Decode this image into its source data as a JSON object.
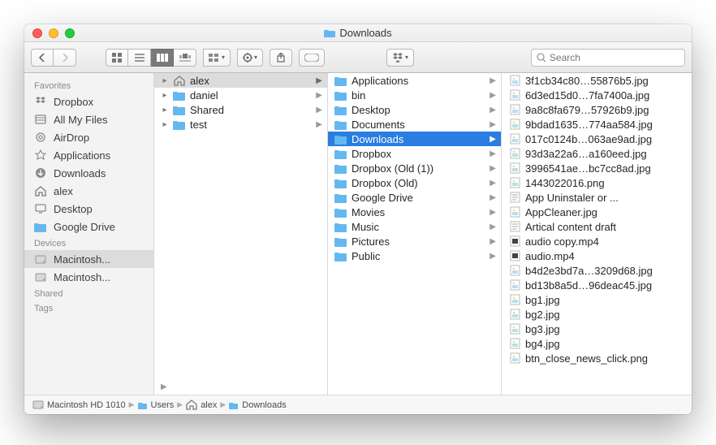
{
  "title": "Downloads",
  "search": {
    "placeholder": "Search"
  },
  "sidebar": {
    "sections": [
      {
        "header": "Favorites",
        "items": [
          {
            "icon": "dropbox",
            "label": "Dropbox"
          },
          {
            "icon": "allfiles",
            "label": "All My Files"
          },
          {
            "icon": "airdrop",
            "label": "AirDrop"
          },
          {
            "icon": "apps",
            "label": "Applications"
          },
          {
            "icon": "downloads",
            "label": "Downloads"
          },
          {
            "icon": "home",
            "label": "alex"
          },
          {
            "icon": "desktop",
            "label": "Desktop"
          },
          {
            "icon": "folder",
            "label": "Google Drive"
          }
        ]
      },
      {
        "header": "Devices",
        "items": [
          {
            "icon": "disk",
            "label": "Macintosh...",
            "selected": true
          },
          {
            "icon": "disk",
            "label": "Macintosh..."
          }
        ]
      },
      {
        "header": "Shared",
        "items": []
      },
      {
        "header": "Tags",
        "items": []
      }
    ]
  },
  "columns": [
    {
      "items": [
        {
          "icon": "home",
          "label": "alex",
          "expand": true,
          "arrow": true,
          "selected": true
        },
        {
          "icon": "folder",
          "label": "daniel",
          "expand": true,
          "arrow": true
        },
        {
          "icon": "folder",
          "label": "Shared",
          "expand": true,
          "arrow": true
        },
        {
          "icon": "folder",
          "label": "test",
          "expand": true,
          "arrow": true
        }
      ],
      "bottomArrow": true
    },
    {
      "items": [
        {
          "icon": "folder",
          "label": "Applications",
          "arrow": true
        },
        {
          "icon": "folder",
          "label": "bin",
          "arrow": true
        },
        {
          "icon": "folder",
          "label": "Desktop",
          "arrow": true
        },
        {
          "icon": "folder",
          "label": "Documents",
          "arrow": true
        },
        {
          "icon": "folder",
          "label": "Downloads",
          "arrow": true,
          "highlight": true
        },
        {
          "icon": "folder",
          "label": "Dropbox",
          "arrow": true
        },
        {
          "icon": "folder",
          "label": "Dropbox (Old (1))",
          "arrow": true
        },
        {
          "icon": "folder",
          "label": "Dropbox (Old)",
          "arrow": true
        },
        {
          "icon": "folder",
          "label": "Google Drive",
          "arrow": true
        },
        {
          "icon": "folder",
          "label": "Movies",
          "arrow": true
        },
        {
          "icon": "folder",
          "label": "Music",
          "arrow": true
        },
        {
          "icon": "folder",
          "label": "Pictures",
          "arrow": true
        },
        {
          "icon": "folder",
          "label": "Public",
          "arrow": true
        }
      ]
    },
    {
      "items": [
        {
          "icon": "jpg",
          "label": "3f1cb34c80…55876b5.jpg"
        },
        {
          "icon": "jpg",
          "label": "6d3ed15d0…7fa7400a.jpg"
        },
        {
          "icon": "jpg",
          "label": "9a8c8fa679…57926b9.jpg"
        },
        {
          "icon": "jpg",
          "label": "9bdad1635…774aa584.jpg"
        },
        {
          "icon": "jpg",
          "label": "017c0124b…063ae9ad.jpg"
        },
        {
          "icon": "jpg",
          "label": "93d3a22a6…a160eed.jpg"
        },
        {
          "icon": "jpg",
          "label": "3996541ae…bc7cc8ad.jpg"
        },
        {
          "icon": "png",
          "label": "1443022016.png"
        },
        {
          "icon": "doc",
          "label": "App Uninstaler or ..."
        },
        {
          "icon": "jpg",
          "label": "AppCleaner.jpg"
        },
        {
          "icon": "doc",
          "label": "Artical content draft"
        },
        {
          "icon": "mp4",
          "label": "audio copy.mp4"
        },
        {
          "icon": "mp4",
          "label": "audio.mp4"
        },
        {
          "icon": "jpg",
          "label": "b4d2e3bd7a…3209d68.jpg"
        },
        {
          "icon": "jpg",
          "label": "bd13b8a5d…96deac45.jpg"
        },
        {
          "icon": "jpg",
          "label": "bg1.jpg"
        },
        {
          "icon": "jpg",
          "label": "bg2.jpg"
        },
        {
          "icon": "jpg",
          "label": "bg3.jpg"
        },
        {
          "icon": "jpg",
          "label": "bg4.jpg"
        },
        {
          "icon": "png",
          "label": "btn_close_news_click.png"
        }
      ]
    }
  ],
  "pathbar": [
    {
      "icon": "disk",
      "label": "Macintosh HD 1010"
    },
    {
      "icon": "folder",
      "label": "Users"
    },
    {
      "icon": "home",
      "label": "alex"
    },
    {
      "icon": "folder",
      "label": "Downloads"
    }
  ]
}
